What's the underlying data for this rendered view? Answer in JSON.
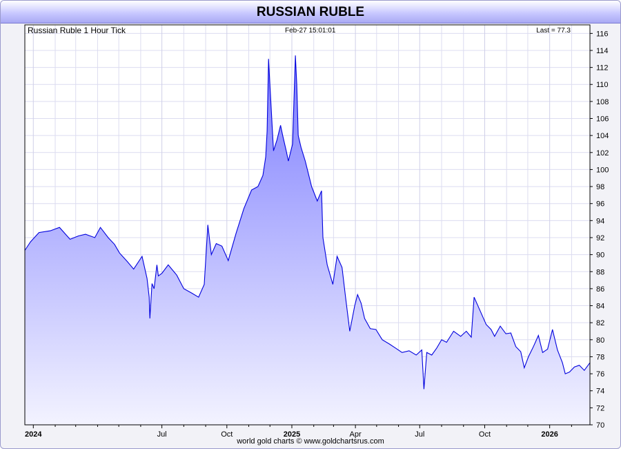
{
  "colors": {
    "line": "#0000dd",
    "area_top": "#7b7bff",
    "area_bottom": "#f3f3ff",
    "grid": "#dcdcf0"
  },
  "chart_data": {
    "type": "area",
    "title": "RUSSIAN RUBLE",
    "subtitle": "Russian Ruble 1 Hour Tick",
    "timestamp": "Feb-27  15:01:01",
    "last_label": "Last = 77.3",
    "footer": "world gold charts © www.goldchartsrus.com",
    "x_ticks": [
      {
        "label": "2024",
        "date": "2024-01-01",
        "bold": true
      },
      {
        "label": "Jul",
        "date": "2024-07-01",
        "bold": false
      },
      {
        "label": "Oct",
        "date": "2024-10-01",
        "bold": false
      },
      {
        "label": "2025",
        "date": "2025-01-01",
        "bold": true
      },
      {
        "label": "Apr",
        "date": "2025-04-01",
        "bold": false
      },
      {
        "label": "Jul",
        "date": "2025-07-01",
        "bold": false
      },
      {
        "label": "Oct",
        "date": "2025-10-01",
        "bold": false
      },
      {
        "label": "2026",
        "date": "2026-01-01",
        "bold": true
      }
    ],
    "x_minor_ticks": [
      "2024-02-01",
      "2024-03-01",
      "2024-04-01",
      "2024-05-01",
      "2024-06-01",
      "2024-08-01",
      "2024-09-01",
      "2024-11-01",
      "2024-12-01",
      "2025-02-01",
      "2025-03-01",
      "2025-05-01",
      "2025-06-01",
      "2025-08-01",
      "2025-09-01",
      "2025-11-01",
      "2025-12-01",
      "2026-02-01"
    ],
    "xlim": [
      "2023-12-20",
      "2026-02-27"
    ],
    "y_ticks": [
      70,
      72,
      74,
      76,
      78,
      80,
      82,
      84,
      86,
      88,
      90,
      92,
      94,
      96,
      98,
      100,
      102,
      104,
      106,
      108,
      110,
      112,
      114,
      116
    ],
    "ylim": [
      70,
      117
    ],
    "grid": true,
    "series": [
      {
        "x": [
          "2023-12-20",
          "2023-12-28",
          "2024-01-09",
          "2024-01-25",
          "2024-02-07",
          "2024-02-22",
          "2024-03-05",
          "2024-03-15",
          "2024-03-28",
          "2024-04-05",
          "2024-04-16",
          "2024-04-25",
          "2024-05-02",
          "2024-05-13",
          "2024-05-22",
          "2024-06-03",
          "2024-06-10",
          "2024-06-13",
          "2024-06-14",
          "2024-06-17",
          "2024-06-20",
          "2024-06-24",
          "2024-06-26",
          "2024-07-01",
          "2024-07-10",
          "2024-07-22",
          "2024-08-01",
          "2024-08-12",
          "2024-08-22",
          "2024-08-30",
          "2024-09-04",
          "2024-09-09",
          "2024-09-16",
          "2024-09-24",
          "2024-10-03",
          "2024-10-14",
          "2024-10-25",
          "2024-11-05",
          "2024-11-14",
          "2024-11-21",
          "2024-11-25",
          "2024-11-27",
          "2024-11-29",
          "2024-12-03",
          "2024-12-06",
          "2024-12-11",
          "2024-12-16",
          "2024-12-19",
          "2024-12-24",
          "2024-12-27",
          "2025-01-02",
          "2025-01-06",
          "2025-01-08",
          "2025-01-10",
          "2025-01-14",
          "2025-01-20",
          "2025-01-29",
          "2025-02-06",
          "2025-02-12",
          "2025-02-14",
          "2025-02-20",
          "2025-02-28",
          "2025-03-06",
          "2025-03-13",
          "2025-03-18",
          "2025-03-24",
          "2025-03-31",
          "2025-04-04",
          "2025-04-09",
          "2025-04-14",
          "2025-04-22",
          "2025-04-30",
          "2025-05-09",
          "2025-05-19",
          "2025-05-28",
          "2025-06-06",
          "2025-06-16",
          "2025-06-26",
          "2025-07-04",
          "2025-07-07",
          "2025-07-11",
          "2025-07-18",
          "2025-07-25",
          "2025-08-01",
          "2025-08-08",
          "2025-08-18",
          "2025-08-28",
          "2025-09-05",
          "2025-09-12",
          "2025-09-16",
          "2025-09-24",
          "2025-10-03",
          "2025-10-10",
          "2025-10-15",
          "2025-10-23",
          "2025-10-31",
          "2025-11-07",
          "2025-11-14",
          "2025-11-21",
          "2025-11-26",
          "2025-12-02",
          "2025-12-09",
          "2025-12-16",
          "2025-12-22",
          "2025-12-29",
          "2026-01-05",
          "2026-01-12",
          "2026-01-19",
          "2026-01-23",
          "2026-01-29",
          "2026-02-05",
          "2026-02-12",
          "2026-02-19",
          "2026-02-27"
        ],
        "y": [
          90.5,
          91.5,
          92.6,
          92.8,
          93.2,
          91.8,
          92.2,
          92.4,
          92.0,
          93.2,
          92.0,
          91.2,
          90.2,
          89.2,
          88.3,
          89.8,
          87.2,
          85.0,
          82.5,
          86.6,
          86.0,
          88.8,
          87.5,
          87.8,
          88.8,
          87.6,
          86.0,
          85.5,
          85.0,
          86.5,
          93.5,
          90.0,
          91.3,
          91.0,
          89.3,
          92.5,
          95.4,
          97.6,
          98.0,
          99.3,
          101.5,
          104.5,
          113.0,
          106.8,
          102.2,
          103.5,
          105.2,
          104.0,
          102.2,
          101.0,
          103.0,
          113.4,
          110.0,
          104.0,
          102.6,
          101.0,
          98.0,
          96.3,
          97.5,
          92.0,
          88.8,
          86.5,
          89.8,
          88.5,
          85.0,
          81.0,
          84.0,
          85.3,
          84.3,
          82.5,
          81.3,
          81.2,
          80.0,
          79.5,
          79.0,
          78.5,
          78.7,
          78.2,
          78.8,
          74.2,
          78.5,
          78.2,
          79.0,
          80.0,
          79.7,
          81.0,
          80.4,
          81.0,
          80.3,
          85.0,
          83.5,
          81.8,
          81.2,
          80.4,
          81.6,
          80.7,
          80.8,
          79.2,
          78.6,
          76.7,
          78.0,
          79.2,
          80.5,
          78.5,
          78.9,
          81.2,
          78.8,
          77.3,
          76.0,
          76.2,
          76.8,
          77.0,
          76.4,
          77.3
        ]
      }
    ]
  }
}
